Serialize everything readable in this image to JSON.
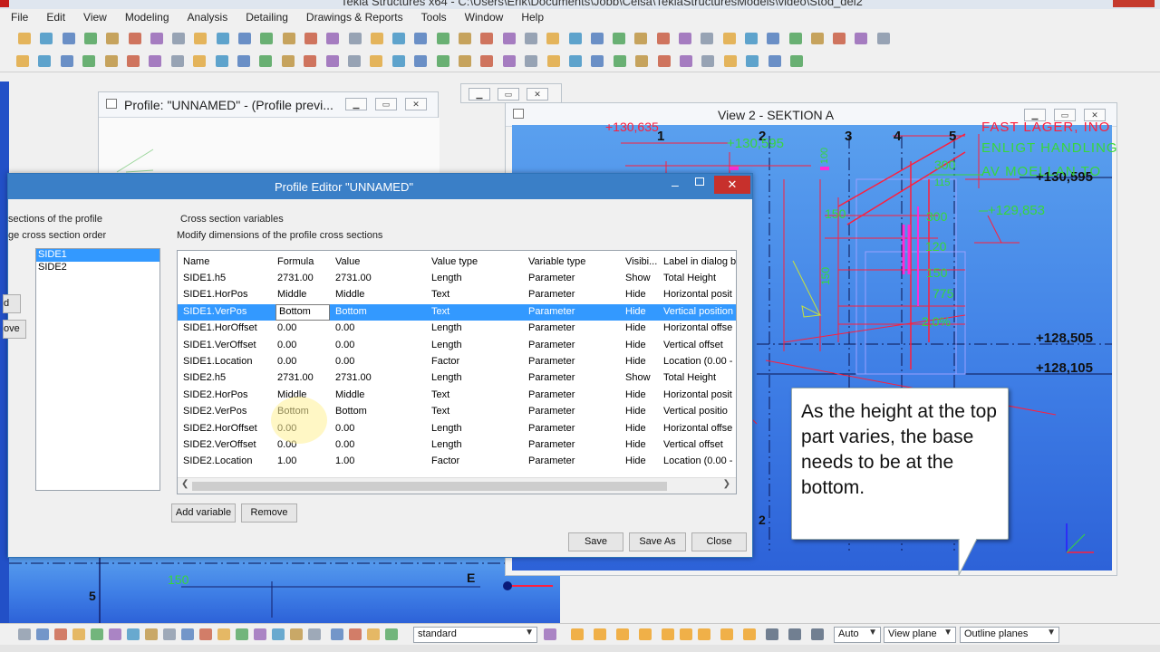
{
  "window": {
    "title": "Tekla Structures x64 - C:\\Users\\Erik\\Documents\\Jobb\\Celsa\\TeklaStructuresModels\\video\\Stod_del2"
  },
  "menu": [
    "File",
    "Edit",
    "View",
    "Modeling",
    "Analysis",
    "Detailing",
    "Drawings & Reports",
    "Tools",
    "Window",
    "Help"
  ],
  "profile_preview": {
    "title": "Profile: \"UNNAMED\" - (Profile previ..."
  },
  "view2": {
    "title": "View 2 - SEKTION A",
    "grid_labels": [
      "1",
      "2",
      "3",
      "4",
      "5"
    ],
    "levels": [
      "+130,595",
      "+128,505",
      "+128,105"
    ],
    "green_levels": [
      "+130,595",
      "+129,853"
    ],
    "notes": [
      "FAST LAGER, INO",
      "ENLIGT HANDLING",
      "AV MOELLAN TO"
    ],
    "dims": [
      "300",
      "150",
      "300",
      "120",
      "150",
      "775",
      "2,0%",
      "100",
      "150",
      "115"
    ],
    "red_marks": [
      "+130,635"
    ]
  },
  "back_view": {
    "labels": [
      "5",
      "E",
      "150"
    ]
  },
  "dialog": {
    "title": "Profile Editor  \"UNNAMED\"",
    "left_header": "sections of the profile",
    "left_sub": "ge cross section order",
    "sections": [
      "SIDE1",
      "SIDE2"
    ],
    "left_buttons": [
      "d",
      "ove"
    ],
    "group_label": "Cross section variables",
    "description": "Modify dimensions of the profile cross sections",
    "columns": [
      "Name",
      "Formula",
      "Value",
      "Value type",
      "Variable type",
      "Visibi...",
      "Label in dialog b"
    ],
    "rows": [
      [
        "SIDE1.h5",
        "2731.00",
        "2731.00",
        "Length",
        "Parameter",
        "Show",
        "Total Height"
      ],
      [
        "SIDE1.HorPos",
        "Middle",
        "Middle",
        "Text",
        "Parameter",
        "Hide",
        "Horizontal posit"
      ],
      [
        "SIDE1.VerPos",
        "Bottom",
        "Bottom",
        "Text",
        "Parameter",
        "Hide",
        "Vertical position"
      ],
      [
        "SIDE1.HorOffset",
        "0.00",
        "0.00",
        "Length",
        "Parameter",
        "Hide",
        "Horizontal offse"
      ],
      [
        "SIDE1.VerOffset",
        "0.00",
        "0.00",
        "Length",
        "Parameter",
        "Hide",
        "Vertical offset"
      ],
      [
        "SIDE1.Location",
        "0.00",
        "0.00",
        "Factor",
        "Parameter",
        "Hide",
        "Location (0.00 -"
      ],
      [
        "SIDE2.h5",
        "2731.00",
        "2731.00",
        "Length",
        "Parameter",
        "Show",
        "Total Height"
      ],
      [
        "SIDE2.HorPos",
        "Middle",
        "Middle",
        "Text",
        "Parameter",
        "Hide",
        "Horizontal posit"
      ],
      [
        "SIDE2.VerPos",
        "Bottom",
        "Bottom",
        "Text",
        "Parameter",
        "Hide",
        "Vertical positio"
      ],
      [
        "SIDE2.HorOffset",
        "0.00",
        "0.00",
        "Length",
        "Parameter",
        "Hide",
        "Horizontal offse"
      ],
      [
        "SIDE2.VerOffset",
        "0.00",
        "0.00",
        "Length",
        "Parameter",
        "Hide",
        "Vertical offset"
      ],
      [
        "SIDE2.Location",
        "1.00",
        "1.00",
        "Factor",
        "Parameter",
        "Hide",
        "Location (0.00 -"
      ]
    ],
    "selected_row": 2,
    "buttons": {
      "add": "Add variable",
      "remove": "Remove",
      "save": "Save",
      "save_as": "Save As",
      "close": "Close"
    }
  },
  "callout": {
    "text": "As the height at the top part varies, the base needs to be at the bottom."
  },
  "bottombar": {
    "filter": "standard",
    "auto": "Auto",
    "view_plane": "View plane",
    "outline": "Outline planes"
  },
  "colors": {
    "cad_blue": "#3f7fe6",
    "dialog_title": "#3a7fc7",
    "selection": "#3399ff",
    "red": "#ff1e3c",
    "green": "#37d73c"
  }
}
